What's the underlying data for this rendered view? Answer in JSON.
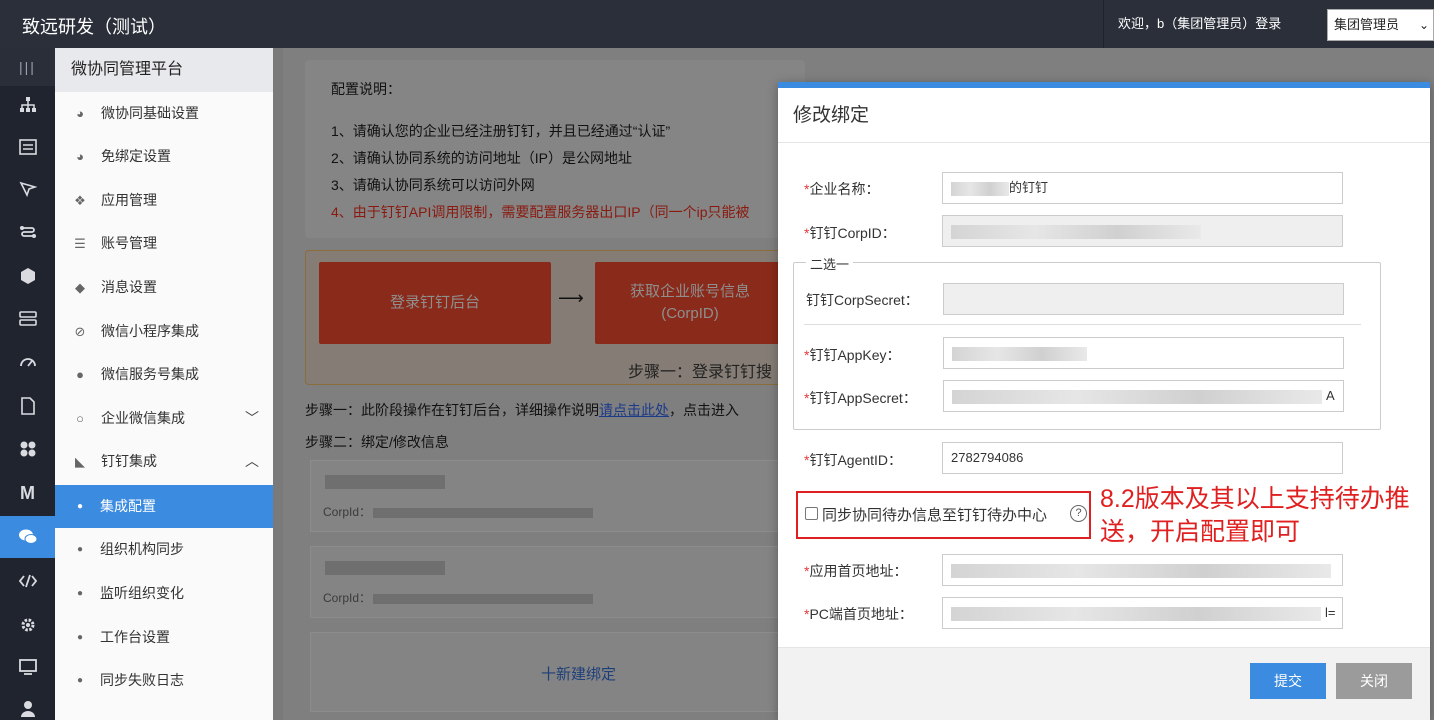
{
  "app": {
    "title": "致远研发（测试）"
  },
  "header": {
    "welcome": "欢迎，b（集团管理员）登录",
    "role_select": "集团管理员"
  },
  "rail": {
    "menu_icon": "|||"
  },
  "sidebar": {
    "title": "微协同管理平台",
    "items": [
      {
        "label": "微协同基础设置",
        "icon": "dashboard-icon"
      },
      {
        "label": "免绑定设置",
        "icon": "dashboard-icon"
      },
      {
        "label": "应用管理",
        "icon": "cubes-icon"
      },
      {
        "label": "账号管理",
        "icon": "user-list-icon"
      },
      {
        "label": "消息设置",
        "icon": "bell-icon"
      },
      {
        "label": "微信小程序集成",
        "icon": "link-icon"
      },
      {
        "label": "微信服务号集成",
        "icon": "wechat-icon"
      },
      {
        "label": "企业微信集成",
        "icon": "chat-icon"
      },
      {
        "label": "钉钉集成",
        "icon": "dingtalk-icon"
      }
    ],
    "sub_items": [
      {
        "label": "集成配置",
        "active": true
      },
      {
        "label": "组织机构同步"
      },
      {
        "label": "监听组织变化"
      },
      {
        "label": "工作台设置"
      },
      {
        "label": "同步失败日志"
      }
    ]
  },
  "main": {
    "notice_title": "配置说明：",
    "notice_lines": [
      "1、请确认您的企业已经注册钉钉，并且已经通过“认证”",
      "2、请确认协同系统的访问地址（IP）是公网地址",
      "3、请确认协同系统可以访问外网",
      "4、由于钉钉API调用限制，需要配置服务器出口IP（同一个ip只能被"
    ],
    "step_card_1": "登录钉钉后台",
    "step_card_2_line1": "获取企业账号信息",
    "step_card_2_line2": "(CorpID)",
    "step_caption": "步骤一：登录钉钉搜",
    "step1_text": "步骤一：此阶段操作在钉钉后台，详细操作说明",
    "step1_link": "请点击此处",
    "step1_suffix": "，点击进入",
    "step2_text": "步骤二：绑定/修改信息",
    "corp_prefix": "CorpId：",
    "new_bind": "十新建绑定"
  },
  "modal": {
    "title": "修改绑定",
    "fields": {
      "company_name_label": "企业名称：",
      "company_name_value": "的钉钉",
      "corp_id_label": "钉钉CorpID：",
      "legend": "二选一",
      "corp_secret_label": "钉钉CorpSecret：",
      "app_key_label": "钉钉AppKey：",
      "app_secret_label": "钉钉AppSecret：",
      "app_secret_end": "A",
      "agent_id_label": "钉钉AgentID：",
      "agent_id_value": "2782794086",
      "home_url_label": "应用首页地址：",
      "pc_url_label": "PC端首页地址：",
      "pc_url_end": "l="
    },
    "sync_label": "同步协同待办信息至钉钉待办中心",
    "help_icon": "?",
    "annotation": "8.2版本及其以上支持待办推送，开启配置即可",
    "submit_label": "提交",
    "close_label": "关闭"
  },
  "colors": {
    "primary": "#3b8be0",
    "danger": "#e02020",
    "topbar": "#2b2f3a",
    "rail": "#20242e"
  }
}
